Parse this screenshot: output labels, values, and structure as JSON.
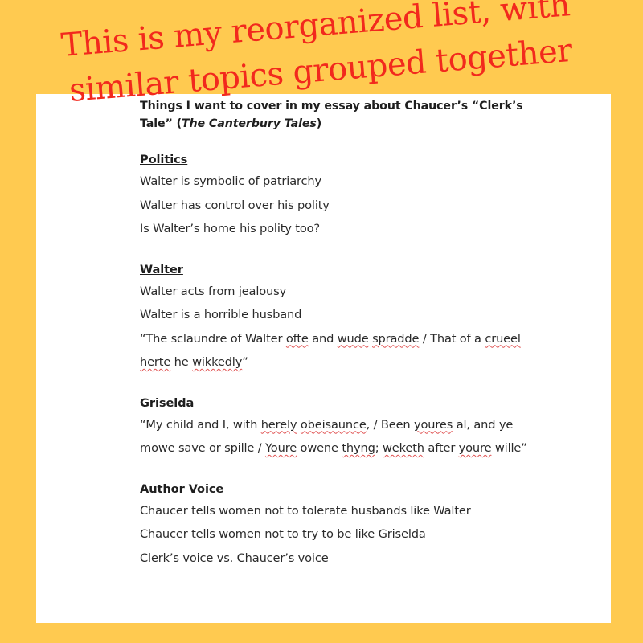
{
  "annotation": {
    "line1": "This is my reorganized list, with",
    "line2": "similar topics grouped together",
    "color": "#F2291D"
  },
  "background_color": "#FFCA50",
  "document": {
    "title_part1": "Things I want to cover in my essay about Chaucer’s “Clerk’s Tale” (",
    "title_italic": "The Canterbury Tales",
    "title_part2": ")",
    "sections": [
      {
        "heading": "Politics",
        "lines": [
          "Walter is symbolic of patriarchy",
          "Walter has control over his polity",
          "Is Walter’s home his polity too?"
        ]
      },
      {
        "heading": "Walter",
        "lines": [
          "Walter acts from jealousy",
          "Walter is a horrible husband"
        ],
        "quote": [
          {
            "t": "“The sclaundre of Walter "
          },
          {
            "t": "ofte",
            "sp": true
          },
          {
            "t": " and "
          },
          {
            "t": "wude",
            "sp": true
          },
          {
            "t": " "
          },
          {
            "t": "spradde",
            "sp": true
          },
          {
            "t": " / That of a "
          },
          {
            "t": "crueel",
            "sp": true
          },
          {
            "t": " "
          },
          {
            "t": "herte",
            "sp": true
          },
          {
            "t": " he "
          },
          {
            "t": "wikkedly",
            "sp": true
          },
          {
            "t": "”"
          }
        ]
      },
      {
        "heading": "Griselda",
        "lines": [],
        "quote": [
          {
            "t": "“My child and I, with "
          },
          {
            "t": "herely",
            "sp": true
          },
          {
            "t": " "
          },
          {
            "t": "obeisaunce",
            "sp": true
          },
          {
            "t": ", / Been "
          },
          {
            "t": "youres",
            "sp": true
          },
          {
            "t": " al, and ye mowe save or spille / "
          },
          {
            "t": "Youre",
            "sp": true
          },
          {
            "t": " owene "
          },
          {
            "t": "thyng",
            "sp": true
          },
          {
            "t": "; "
          },
          {
            "t": "weketh",
            "sp": true
          },
          {
            "t": " after "
          },
          {
            "t": "youre",
            "sp": true
          },
          {
            "t": " wille”"
          }
        ]
      },
      {
        "heading": "Author Voice",
        "lines": [
          "Chaucer tells women not to tolerate husbands like Walter",
          "Chaucer tells women not to try to be like Griselda",
          "Clerk’s voice vs. Chaucer’s voice"
        ]
      }
    ]
  }
}
